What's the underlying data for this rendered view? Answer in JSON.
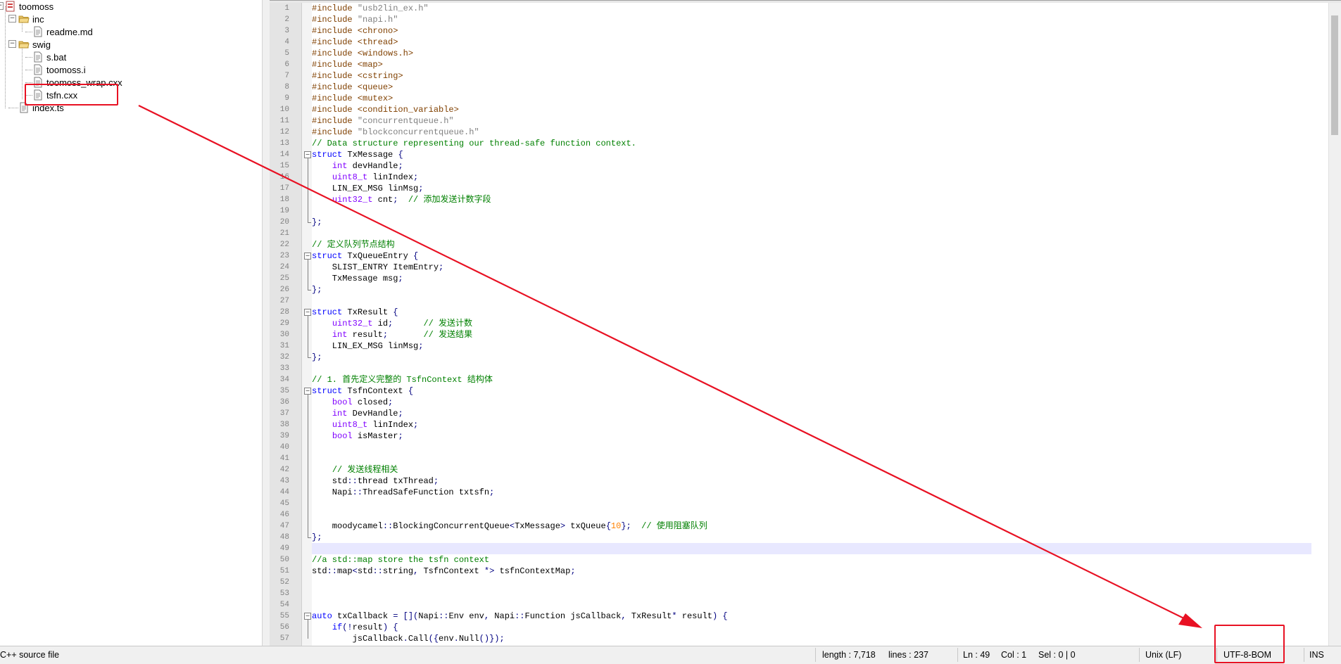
{
  "tree": {
    "nodes": [
      {
        "label": "toomoss",
        "kind": "project"
      },
      {
        "label": "inc",
        "kind": "folder"
      },
      {
        "label": "readme.md",
        "kind": "file"
      },
      {
        "label": "swig",
        "kind": "folder"
      },
      {
        "label": "s.bat",
        "kind": "file"
      },
      {
        "label": "toomoss.i",
        "kind": "file"
      },
      {
        "label": "toomoss_wrap.cxx",
        "kind": "file"
      },
      {
        "label": "tsfn.cxx",
        "kind": "file"
      },
      {
        "label": "index.ts",
        "kind": "file"
      }
    ]
  },
  "editor": {
    "current_line": 49,
    "lines": [
      {
        "n": "1",
        "h": "<span class='pp'>#include </span><span class='str'>\"usb2lin_ex.h\"</span>"
      },
      {
        "n": "2",
        "h": "<span class='pp'>#include </span><span class='str'>\"napi.h\"</span>"
      },
      {
        "n": "3",
        "h": "<span class='pp'>#include &lt;chrono&gt;</span>"
      },
      {
        "n": "4",
        "h": "<span class='pp'>#include &lt;thread&gt;</span>"
      },
      {
        "n": "5",
        "h": "<span class='pp'>#include &lt;windows.h&gt;</span>"
      },
      {
        "n": "6",
        "h": "<span class='pp'>#include &lt;map&gt;</span>"
      },
      {
        "n": "7",
        "h": "<span class='pp'>#include &lt;cstring&gt;</span>"
      },
      {
        "n": "8",
        "h": "<span class='pp'>#include &lt;queue&gt;</span>"
      },
      {
        "n": "9",
        "h": "<span class='pp'>#include &lt;mutex&gt;</span>"
      },
      {
        "n": "10",
        "h": "<span class='pp'>#include &lt;condition_variable&gt;</span>"
      },
      {
        "n": "11",
        "h": "<span class='pp'>#include </span><span class='str'>\"concurrentqueue.h\"</span>"
      },
      {
        "n": "12",
        "h": "<span class='pp'>#include </span><span class='str'>\"blockconcurrentqueue.h\"</span>"
      },
      {
        "n": "13",
        "h": "<span class='cm'>// Data structure representing our thread-safe function context.</span>"
      },
      {
        "n": "14",
        "h": "<span class='kw'>struct</span> TxMessage <span class='op'>{</span>"
      },
      {
        "n": "15",
        "h": "    <span class='ty'>int</span> devHandle<span class='op'>;</span>"
      },
      {
        "n": "16",
        "h": "    <span class='ty'>uint8_t</span> linIndex<span class='op'>;</span>"
      },
      {
        "n": "17",
        "h": "    LIN_EX_MSG linMsg<span class='op'>;</span>"
      },
      {
        "n": "18",
        "h": "    <span class='ty'>uint32_t</span> cnt<span class='op'>;</span>  <span class='cm'>// 添加发送计数字段</span>"
      },
      {
        "n": "19",
        "h": ""
      },
      {
        "n": "20",
        "h": "<span class='op'>};</span>"
      },
      {
        "n": "21",
        "h": ""
      },
      {
        "n": "22",
        "h": "<span class='cm'>// 定义队列节点结构</span>"
      },
      {
        "n": "23",
        "h": "<span class='kw'>struct</span> TxQueueEntry <span class='op'>{</span>"
      },
      {
        "n": "24",
        "h": "    SLIST_ENTRY ItemEntry<span class='op'>;</span>"
      },
      {
        "n": "25",
        "h": "    TxMessage msg<span class='op'>;</span>"
      },
      {
        "n": "26",
        "h": "<span class='op'>};</span>"
      },
      {
        "n": "27",
        "h": ""
      },
      {
        "n": "28",
        "h": "<span class='kw'>struct</span> TxResult <span class='op'>{</span>"
      },
      {
        "n": "29",
        "h": "    <span class='ty'>uint32_t</span> id<span class='op'>;</span>      <span class='cm'>// 发送计数</span>"
      },
      {
        "n": "30",
        "h": "    <span class='ty'>int</span> result<span class='op'>;</span>       <span class='cm'>// 发送结果</span>"
      },
      {
        "n": "31",
        "h": "    LIN_EX_MSG linMsg<span class='op'>;</span>"
      },
      {
        "n": "32",
        "h": "<span class='op'>};</span>"
      },
      {
        "n": "33",
        "h": ""
      },
      {
        "n": "34",
        "h": "<span class='cm'>// 1. 首先定义完整的 TsfnContext 结构体</span>"
      },
      {
        "n": "35",
        "h": "<span class='kw'>struct</span> TsfnContext <span class='op'>{</span>"
      },
      {
        "n": "36",
        "h": "    <span class='ty'>bool</span> closed<span class='op'>;</span>"
      },
      {
        "n": "37",
        "h": "    <span class='ty'>int</span> DevHandle<span class='op'>;</span>"
      },
      {
        "n": "38",
        "h": "    <span class='ty'>uint8_t</span> linIndex<span class='op'>;</span>"
      },
      {
        "n": "39",
        "h": "    <span class='ty'>bool</span> isMaster<span class='op'>;</span>"
      },
      {
        "n": "40",
        "h": ""
      },
      {
        "n": "41",
        "h": ""
      },
      {
        "n": "42",
        "h": "    <span class='cm'>// 发送线程相关</span>"
      },
      {
        "n": "43",
        "h": "    std<span class='op'>::</span>thread txThread<span class='op'>;</span>"
      },
      {
        "n": "44",
        "h": "    Napi<span class='op'>::</span>ThreadSafeFunction txtsfn<span class='op'>;</span>"
      },
      {
        "n": "45",
        "h": ""
      },
      {
        "n": "46",
        "h": ""
      },
      {
        "n": "47",
        "h": "    moodycamel<span class='op'>::</span>BlockingConcurrentQueue<span class='op'>&lt;</span>TxMessage<span class='op'>&gt;</span> txQueue<span class='op'>{</span><span class='num'>10</span><span class='op'>};</span>  <span class='cm'>// 使用阻塞队列</span>"
      },
      {
        "n": "48",
        "h": "<span class='op'>};</span>"
      },
      {
        "n": "49",
        "h": ""
      },
      {
        "n": "50",
        "h": "<span class='cm'>//a std::map store the tsfn context</span>"
      },
      {
        "n": "51",
        "h": "std<span class='op'>::</span>map<span class='op'>&lt;</span>std<span class='op'>::</span>string<span class='op'>,</span> TsfnContext <span class='op'>*&gt;</span> tsfnContextMap<span class='op'>;</span>"
      },
      {
        "n": "52",
        "h": ""
      },
      {
        "n": "53",
        "h": ""
      },
      {
        "n": "54",
        "h": ""
      },
      {
        "n": "55",
        "h": "<span class='kw'>auto</span> txCallback <span class='op'>=</span> <span class='op'>[](</span>Napi<span class='op'>::</span>Env env<span class='op'>,</span> Napi<span class='op'>::</span>Function jsCallback<span class='op'>,</span> TxResult<span class='op'>*</span> result<span class='op'>)</span> <span class='op'>{</span>"
      },
      {
        "n": "56",
        "h": "    <span class='kw'>if</span><span class='op'>(!</span>result<span class='op'>)</span> <span class='op'>{</span>"
      },
      {
        "n": "57",
        "h": "        jsCallback<span class='op'>.</span>Call<span class='op'>({</span>env<span class='op'>.</span>Null<span class='op'>()});</span>"
      }
    ]
  },
  "status": {
    "filetype": "C++ source file",
    "length": "length : 7,718",
    "lines": "lines : 237",
    "ln": "Ln : 49",
    "col": "Col : 1",
    "sel": "Sel : 0 | 0",
    "eol": "Unix (LF)",
    "encoding": "UTF-8-BOM",
    "mode": "INS"
  },
  "colors": {
    "annotation": "#e81123",
    "current_line": "#e8e8ff",
    "keyword": "#0000ff",
    "type": "#8000ff",
    "comment": "#008000",
    "preprocessor": "#804000"
  }
}
